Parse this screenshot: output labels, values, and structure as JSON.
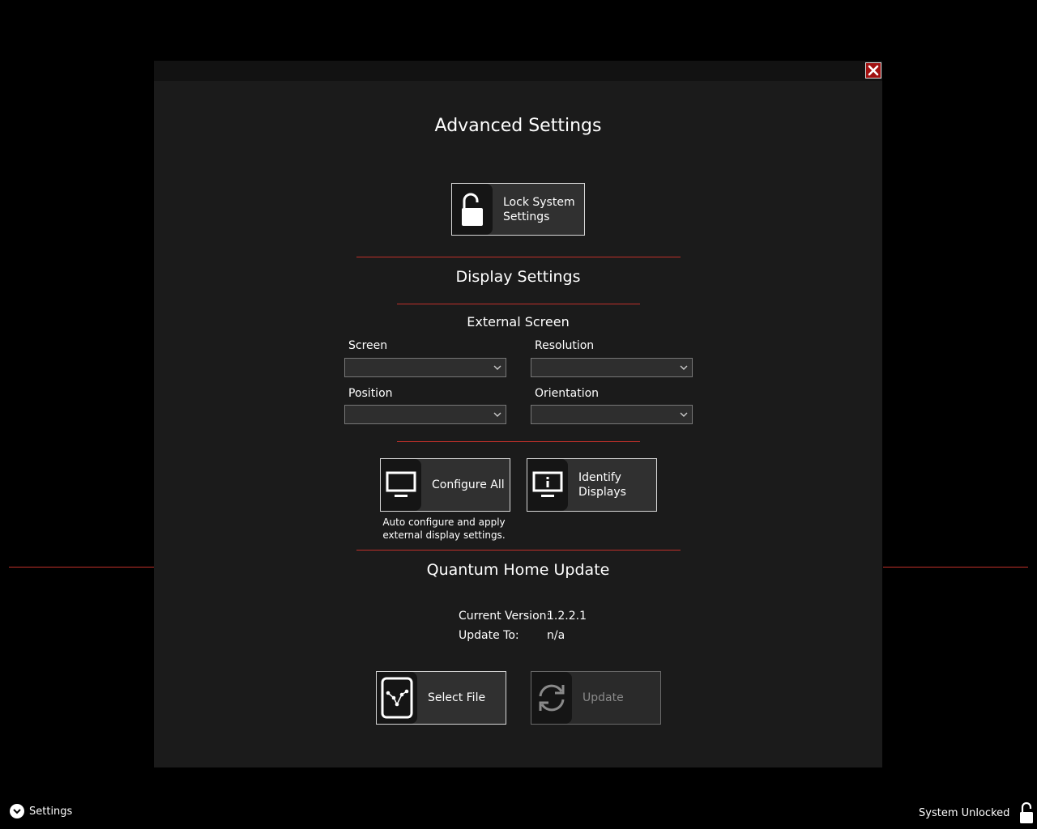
{
  "modal": {
    "title": "Advanced Settings",
    "close_icon": "close-icon"
  },
  "lock_button": {
    "label": "Lock System\nSettings",
    "icon": "unlock-icon"
  },
  "display": {
    "heading": "Display Settings",
    "subheading": "External Screen",
    "fields": {
      "screen": {
        "label": "Screen",
        "value": ""
      },
      "resolution": {
        "label": "Resolution",
        "value": ""
      },
      "position": {
        "label": "Position",
        "value": ""
      },
      "orientation": {
        "label": "Orientation",
        "value": ""
      }
    },
    "configure_all": {
      "label": "Configure All",
      "icon": "monitor-icon"
    },
    "identify": {
      "label": "Identify\nDisplays",
      "icon": "monitor-info-icon"
    },
    "note": "Auto configure and apply\nexternal display settings."
  },
  "update": {
    "heading": "Quantum Home Update",
    "current_label": "Current Version:",
    "current_value": "1.2.2.1",
    "to_label": "Update To:",
    "to_value": "n/a",
    "select_file": {
      "label": "Select File",
      "icon": "file-icon"
    },
    "update_button": {
      "label": "Update",
      "icon": "refresh-icon",
      "enabled": false
    }
  },
  "footer": {
    "settings_label": "Settings",
    "status_label": "System Unlocked"
  },
  "colors": {
    "accent": "#c0302a",
    "close": "#a01010",
    "panel": "#1b1b1b",
    "tile": "#303030"
  }
}
